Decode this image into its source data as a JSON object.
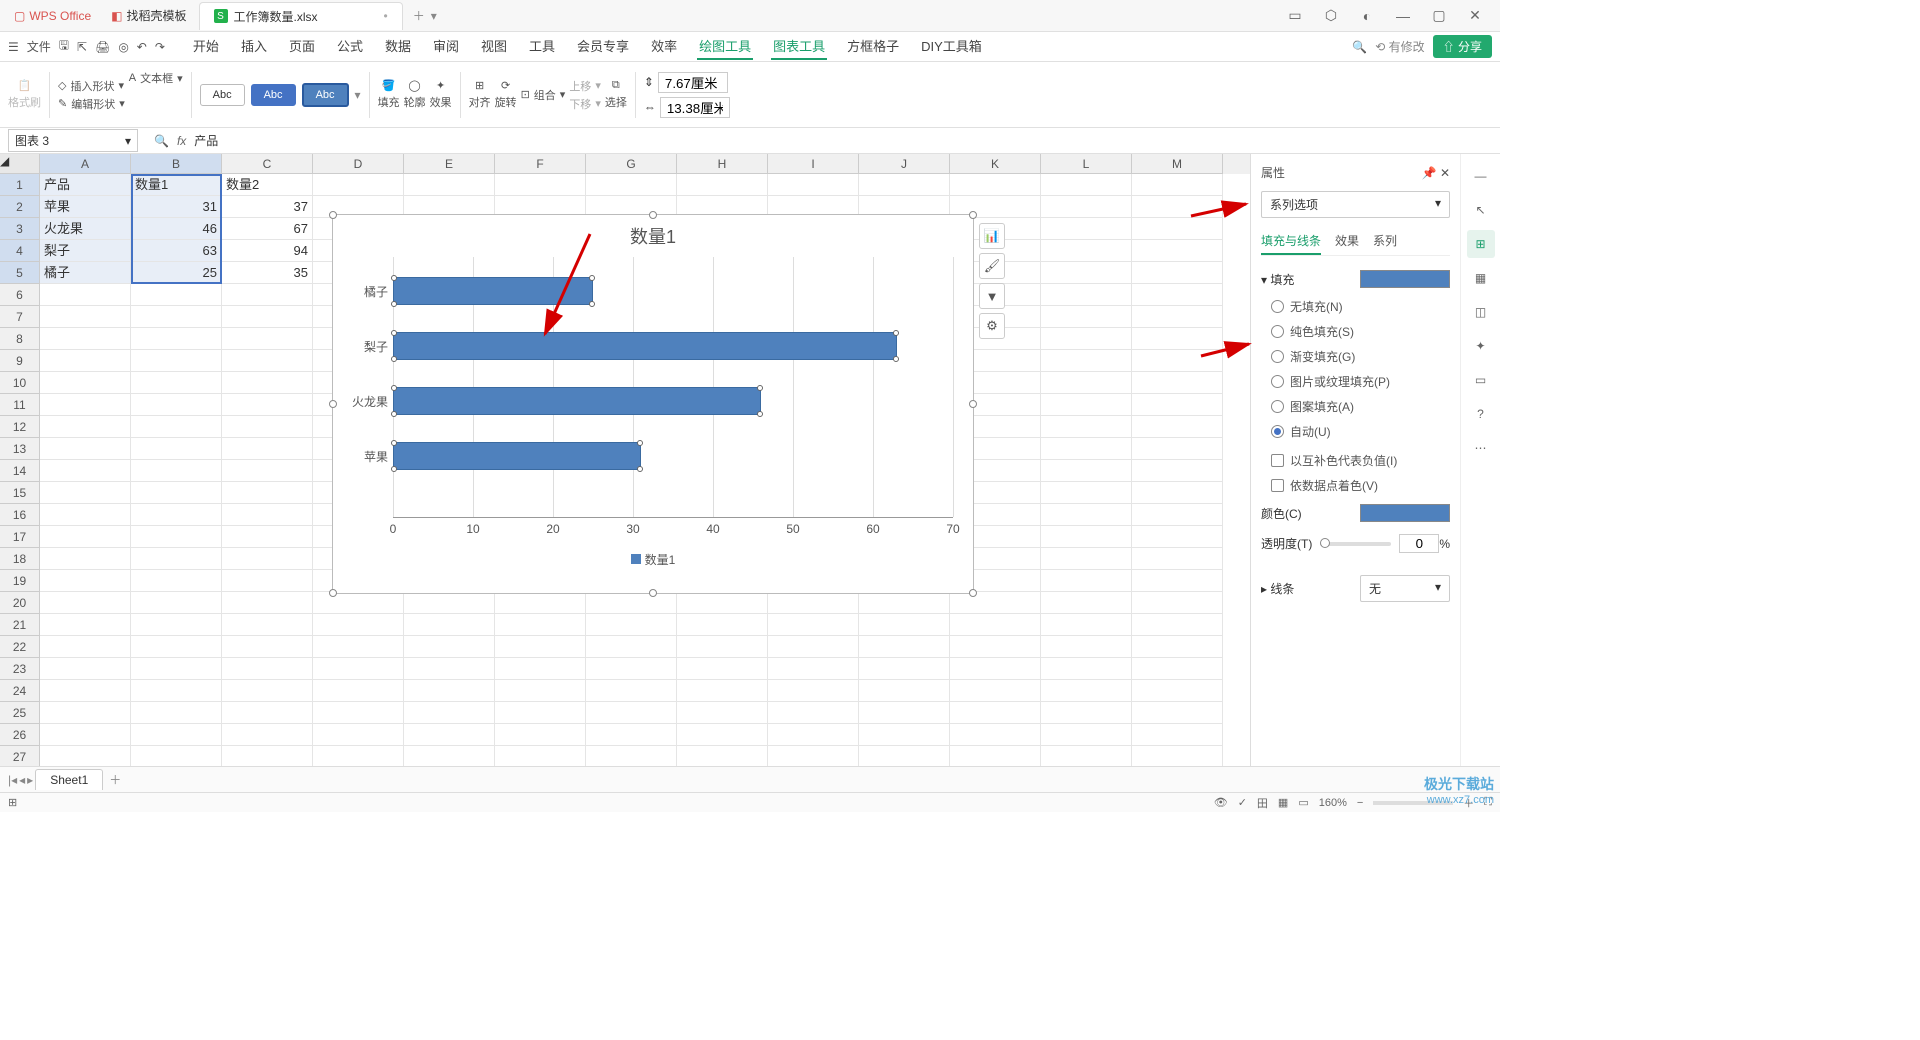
{
  "titlebar": {
    "app_tab": "WPS Office",
    "template_tab": "找稻壳模板",
    "file_tab": "工作簿数量.xlsx"
  },
  "menubar": {
    "file": "文件",
    "items": [
      "开始",
      "插入",
      "页面",
      "公式",
      "数据",
      "审阅",
      "视图",
      "工具",
      "会员专享",
      "效率",
      "绘图工具",
      "图表工具",
      "方框格子",
      "DIY工具箱"
    ],
    "active_index": 10,
    "modify": "有修改",
    "share": "分享"
  },
  "ribbon": {
    "format_painter": "格式刷",
    "insert_shape": "插入形状",
    "edit_shape": "编辑形状",
    "text_box": "文本框",
    "style_labels": [
      "Abc",
      "Abc",
      "Abc"
    ],
    "fill": "填充",
    "outline": "轮廓",
    "effect": "效果",
    "align": "对齐",
    "rotate": "旋转",
    "group": "组合",
    "move_up": "上移",
    "move_down": "下移",
    "select": "选择",
    "height": "7.67厘米",
    "width": "13.38厘米"
  },
  "formula_bar": {
    "name_box": "图表 3",
    "fx": "fx",
    "content": "产品"
  },
  "spreadsheet": {
    "columns": [
      "A",
      "B",
      "C",
      "D",
      "E",
      "F",
      "G",
      "H",
      "I",
      "J",
      "K",
      "L",
      "M"
    ],
    "rows": 27,
    "data": [
      [
        "产品",
        "数量1",
        "数量2"
      ],
      [
        "苹果",
        "31",
        "37"
      ],
      [
        "火龙果",
        "46",
        "67"
      ],
      [
        "梨子",
        "63",
        "94"
      ],
      [
        "橘子",
        "25",
        "35"
      ]
    ]
  },
  "chart_data": {
    "type": "bar",
    "orientation": "horizontal",
    "title": "数量1",
    "categories": [
      "橘子",
      "梨子",
      "火龙果",
      "苹果"
    ],
    "values": [
      25,
      63,
      46,
      31
    ],
    "xlabel": "",
    "ylabel": "",
    "xlim": [
      0,
      70
    ],
    "xticks": [
      0,
      10,
      20,
      30,
      40,
      50,
      60,
      70
    ],
    "legend": [
      "数量1"
    ],
    "legend_position": "bottom",
    "series_color": "#4f81bd"
  },
  "panel": {
    "title": "属性",
    "dropdown": "系列选项",
    "tabs": [
      "填充与线条",
      "效果",
      "系列"
    ],
    "active_tab": 0,
    "fill_section": "填充",
    "fill_options": [
      {
        "label": "无填充(N)",
        "checked": false
      },
      {
        "label": "纯色填充(S)",
        "checked": false
      },
      {
        "label": "渐变填充(G)",
        "checked": false
      },
      {
        "label": "图片或纹理填充(P)",
        "checked": false
      },
      {
        "label": "图案填充(A)",
        "checked": false
      },
      {
        "label": "自动(U)",
        "checked": true
      }
    ],
    "checks": [
      {
        "label": "以互补色代表负值(I)",
        "checked": false
      },
      {
        "label": "依数据点着色(V)",
        "checked": false
      }
    ],
    "color_label": "颜色(C)",
    "opacity_label": "透明度(T)",
    "opacity_value": "0",
    "opacity_unit": "%",
    "line_section": "线条",
    "line_value": "无"
  },
  "sheet_tabs": {
    "sheet1": "Sheet1"
  },
  "status": {
    "zoom": "160%"
  },
  "watermark": {
    "line1": "极光下载站",
    "line2": "www.xz7.com"
  }
}
